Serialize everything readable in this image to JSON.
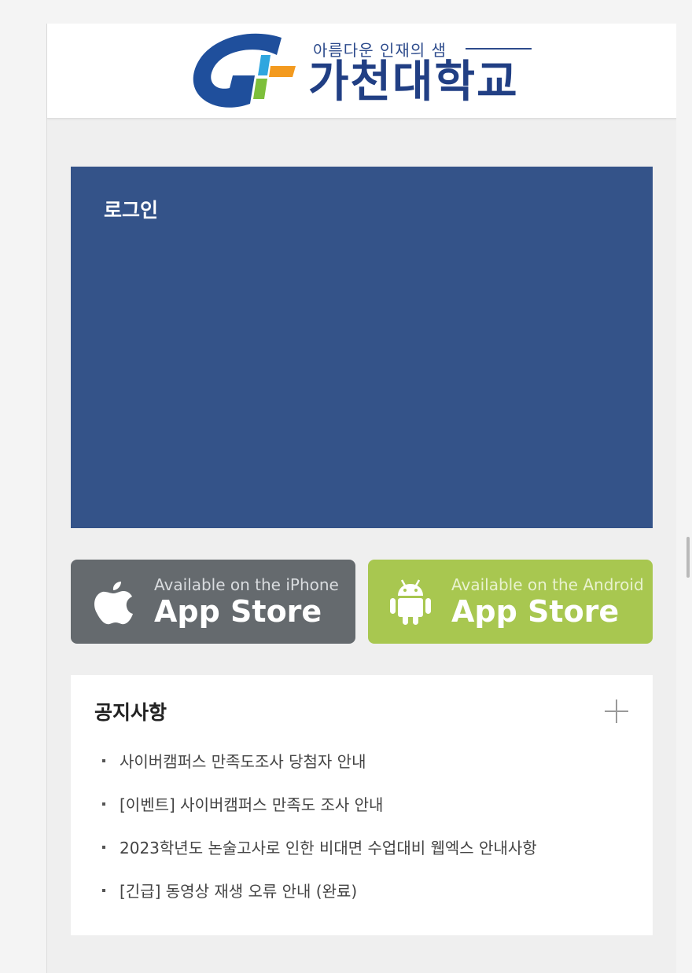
{
  "header": {
    "logo_tagline": "아름다운 인재의 샘",
    "logo_name": "가천대학교",
    "logo_colors": [
      "#1f4f9c",
      "#2fa6df",
      "#f39a1f",
      "#7dbf3b"
    ]
  },
  "login": {
    "title": "로그인",
    "background": "#345389"
  },
  "app_stores": [
    {
      "subtitle": "Available on the iPhone",
      "label": "App Store",
      "icon": "apple-icon",
      "color": "#656a6e"
    },
    {
      "subtitle": "Available on the Android",
      "label": "App Store",
      "icon": "android-icon",
      "color": "#a8c750"
    }
  ],
  "notice": {
    "title": "공지사항",
    "more_icon": "plus-icon",
    "items": [
      "사이버캠퍼스 만족도조사 당첨자 안내",
      "[이벤트] 사이버캠퍼스 만족도 조사 안내",
      "2023학년도 논술고사로 인한 비대면 수업대비 웹엑스 안내사항",
      "[긴급] 동영상 재생 오류 안내 (완료)"
    ]
  }
}
